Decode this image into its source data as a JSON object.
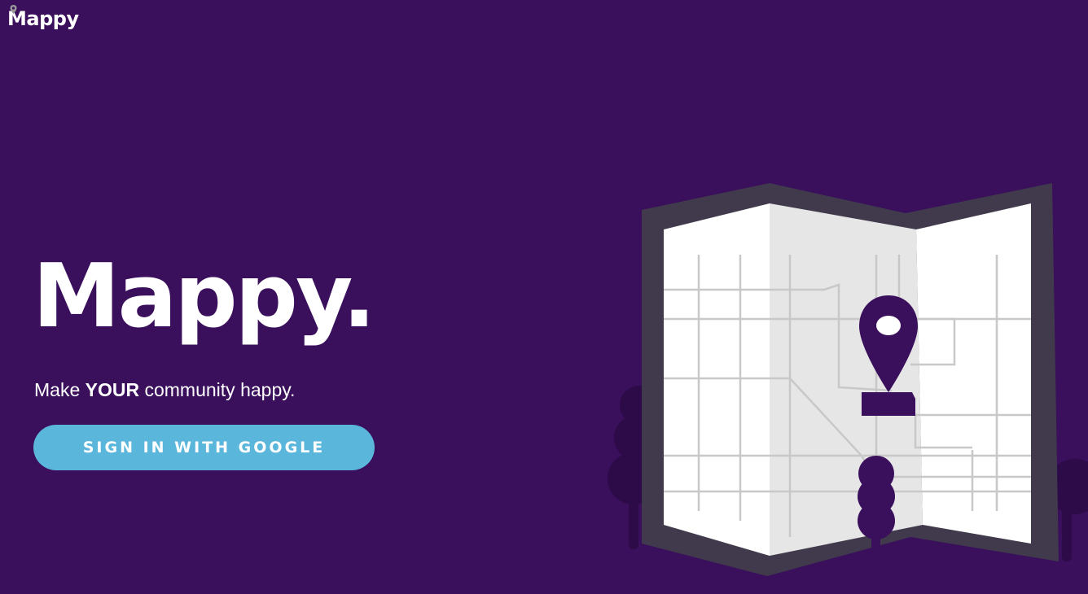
{
  "nav": {
    "logo_text": "Mappy",
    "logo_icon": "map-pin-icon"
  },
  "hero": {
    "title": "Mappy.",
    "tagline_prefix": "Make ",
    "tagline_emphasis": "YOUR",
    "tagline_suffix": " community happy.",
    "signin_label": "SIGN IN WITH GOOGLE"
  },
  "illustration": {
    "icon": "folded-map-with-location-pin",
    "pin_icon": "location-pin-icon",
    "tree_icon": "tree-icon"
  },
  "colors": {
    "background": "#3a0f5c",
    "button": "#5bb6dc",
    "text": "#ffffff",
    "map_frame": "#413a4c",
    "map_paper": "#ffffff",
    "map_fold": "#e6e6e6",
    "map_roads": "#c8c8c8",
    "pin": "#3a0f5c",
    "trees": "#2d0a48"
  }
}
